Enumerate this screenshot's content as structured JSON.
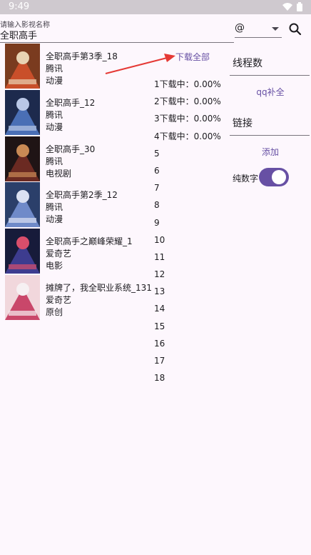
{
  "status_bar": {
    "time": "9:49"
  },
  "search": {
    "hint": "请输入影视名称",
    "value": "全职高手"
  },
  "source_select": {
    "value": "@"
  },
  "results": [
    {
      "title": "全职高手第3季_18",
      "platform": "腾讯",
      "type": "动漫",
      "poster_colors": [
        "#7a3b1f",
        "#c94f2a",
        "#e8d3b3"
      ]
    },
    {
      "title": "全职高手_12",
      "platform": "腾讯",
      "type": "动漫",
      "poster_colors": [
        "#1d2a4d",
        "#4a6fb5",
        "#b9c7e6"
      ]
    },
    {
      "title": "全职高手_30",
      "platform": "腾讯",
      "type": "电视剧",
      "poster_colors": [
        "#1f1415",
        "#6b2a22",
        "#c98a55"
      ]
    },
    {
      "title": "全职高手第2季_12",
      "platform": "腾讯",
      "type": "动漫",
      "poster_colors": [
        "#2b3f6a",
        "#6f8ac9",
        "#dbe1f2"
      ]
    },
    {
      "title": "全职高手之巅峰荣耀_1",
      "platform": "爱奇艺",
      "type": "电影",
      "poster_colors": [
        "#171b3a",
        "#3d3c8f",
        "#d94e6b"
      ]
    },
    {
      "title": "摊牌了，我全职业系统_131",
      "platform": "爱奇艺",
      "type": "原创",
      "poster_colors": [
        "#f1d7dc",
        "#c9476a",
        "#f6f0f2"
      ]
    }
  ],
  "download_all_label": "下载全部",
  "episodes": [
    "1下载中：0.00%",
    "2下载中：0.00%",
    "3下载中：0.00%",
    "4下载中：0.00%",
    "5",
    "6",
    "7",
    "8",
    "9",
    "10",
    "11",
    "12",
    "13",
    "14",
    "15",
    "16",
    "17",
    "18"
  ],
  "settings": {
    "thread_label": "线程数",
    "qq_button": "qq补全",
    "link_label": "链接",
    "add_button": "添加",
    "numeric_label": "纯数字",
    "numeric_toggle_on": true
  },
  "colors": {
    "accent": "#6750a4",
    "annotation_arrow": "#e53935",
    "background": "#fdf7fd"
  }
}
